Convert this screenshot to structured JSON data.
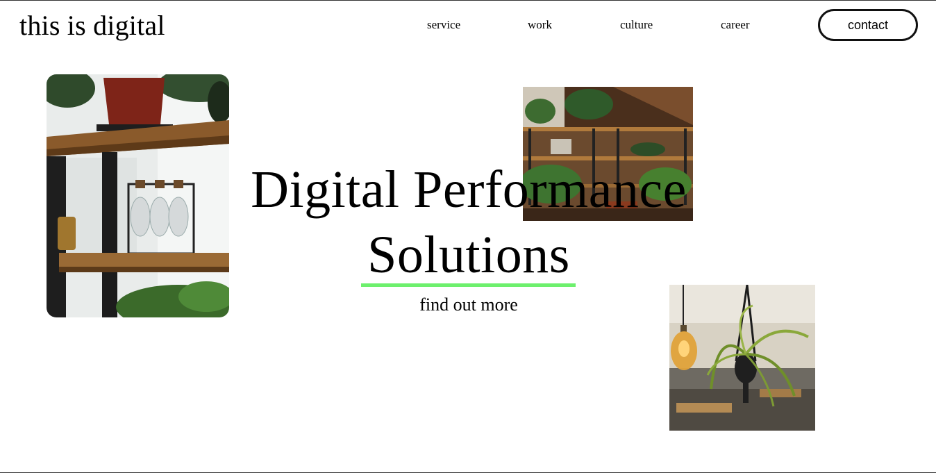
{
  "brand": {
    "logo_text": "this is digital"
  },
  "nav": {
    "items": [
      {
        "label": "service"
      },
      {
        "label": "work"
      },
      {
        "label": "culture"
      },
      {
        "label": "career"
      }
    ],
    "contact_label": "contact"
  },
  "hero": {
    "title_line1": "Digital Performance",
    "title_line2": "Solutions",
    "cta_label": "find out more"
  },
  "images": [
    {
      "name": "shelf-with-plants-and-glass-bottles"
    },
    {
      "name": "office-with-wooden-shelves-and-plants"
    },
    {
      "name": "hanging-plant-and-edison-bulb"
    }
  ],
  "colors": {
    "accent": "#6df06d",
    "text": "#000000",
    "background": "#ffffff"
  }
}
